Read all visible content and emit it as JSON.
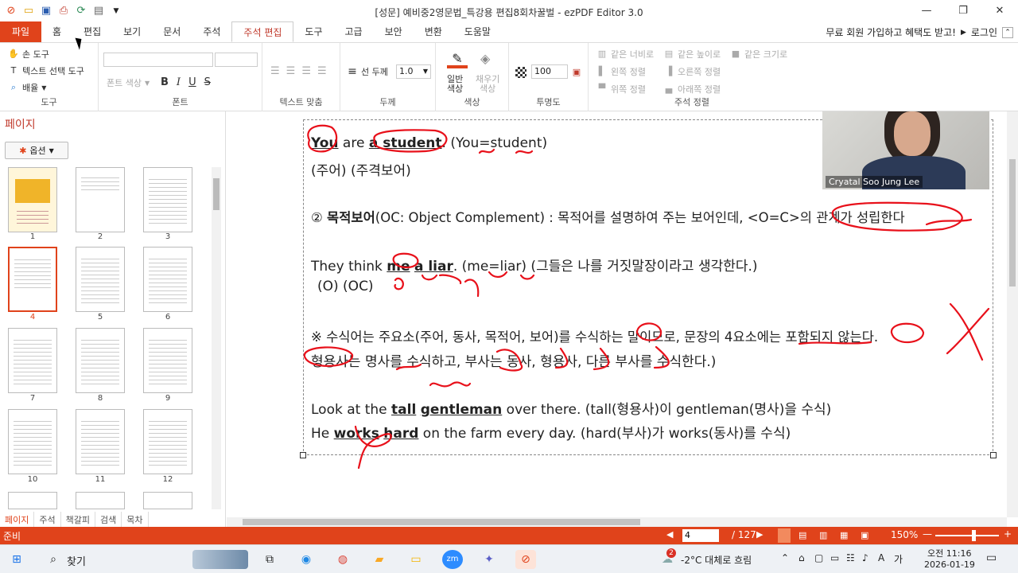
{
  "window": {
    "title": "[성문] 예비중2영문법_특강용 편집8회차꿀벌 - ezPDF Editor 3.0",
    "min": "—",
    "max": "❐",
    "close": "✕"
  },
  "tabs": [
    "파일",
    "홈",
    "편집",
    "보기",
    "문서",
    "주석",
    "주석 편집",
    "도구",
    "고급",
    "보안",
    "변환",
    "도움말"
  ],
  "active_tab": "주석 편집",
  "tabs_right": {
    "promo": "무료 회원 가입하고 혜택도 받고!",
    "login": "로그인"
  },
  "ribbon": {
    "tools": {
      "hand": "손 도구",
      "text_select": "텍스트 선택 도구",
      "arrange": "배율",
      "label": "도구"
    },
    "font": {
      "color": "폰트 색상",
      "bold": "B",
      "italic": "I",
      "underline": "U",
      "strike": "S",
      "label": "폰트"
    },
    "align": {
      "label": "텍스트 맞춤"
    },
    "thickness": {
      "line": "선 두께",
      "value": "1.0",
      "label": "두께"
    },
    "color": {
      "normal": "일반",
      "normal2": "색상",
      "fill": "채우기",
      "fill2": "색상",
      "label": "색상",
      "accent": "#e0431b"
    },
    "opacity": {
      "value": "100",
      "label": "투명도"
    },
    "arrange": {
      "same_width": "같은 너비로",
      "same_height": "같은 높이로",
      "same_size": "같은 크기로",
      "left": "왼쪽 정렬",
      "right": "오른쪽 정렬",
      "top": "위쪽 정렬",
      "bottom": "아래쪽 정렬",
      "label": "주석 정렬"
    }
  },
  "sidebar": {
    "title": "페이지",
    "options": "옵션",
    "thumbs": [
      "1",
      "2",
      "3",
      "4",
      "5",
      "6",
      "7",
      "8",
      "9",
      "10",
      "11",
      "12"
    ],
    "selected": "4",
    "tabs": [
      "페이지",
      "주석",
      "책갈피",
      "검색",
      "목차"
    ]
  },
  "doc": {
    "l1": {
      "you": "You",
      "are": " are ",
      "student": "a student",
      "rest": ". (You=student)"
    },
    "l2": "(주어) (주격보어)",
    "l3": {
      "num": "② ",
      "bold": "목적보어",
      "rest": "(OC: Object Complement) : 목적어를 설명하여 주는 보어인데, <O=C>의 관계가 성립한다"
    },
    "l4": {
      "a": "They think ",
      "me": "me",
      "b": " ",
      "liar": "a liar",
      "c": ". (me=liar) (그들은 나를 거짓말장이라고 생각한다.)"
    },
    "l5": "(O) (OC)",
    "l6": "※ 수식어는 주요소(주어, 동사, 목적어, 보어)를 수식하는 말이므로, 문장의 4요소에는 포함되지 않는다.",
    "l7": "형용사는 명사를 수식하고, 부사는 동사, 형용사, 다른 부사를 수식한다.)",
    "l8": {
      "a": "Look at the ",
      "tall": "tall",
      "b": " ",
      "gent": "gentleman",
      "c": " over there. (tall(형용사)이 gentleman(명사)을 수식)"
    },
    "l9": {
      "a": "He ",
      "works": "works",
      "b": " ",
      "hard": "hard",
      "c": " on the farm every day. (hard(부사)가 works(동사)를 수식)"
    }
  },
  "webcam": {
    "name": "Cryatal Soo Jung Lee"
  },
  "status": {
    "ready": "준비",
    "page": "4",
    "total": "/ 127",
    "zoom": "150%"
  },
  "taskbar": {
    "search": "찾기",
    "weather": "-2°C 대체로 흐림",
    "time": "오전 11:16",
    "date": "2026-01-19",
    "notif": "2"
  },
  "colors": {
    "accent": "#e0431b",
    "ink": "#e8101a"
  }
}
